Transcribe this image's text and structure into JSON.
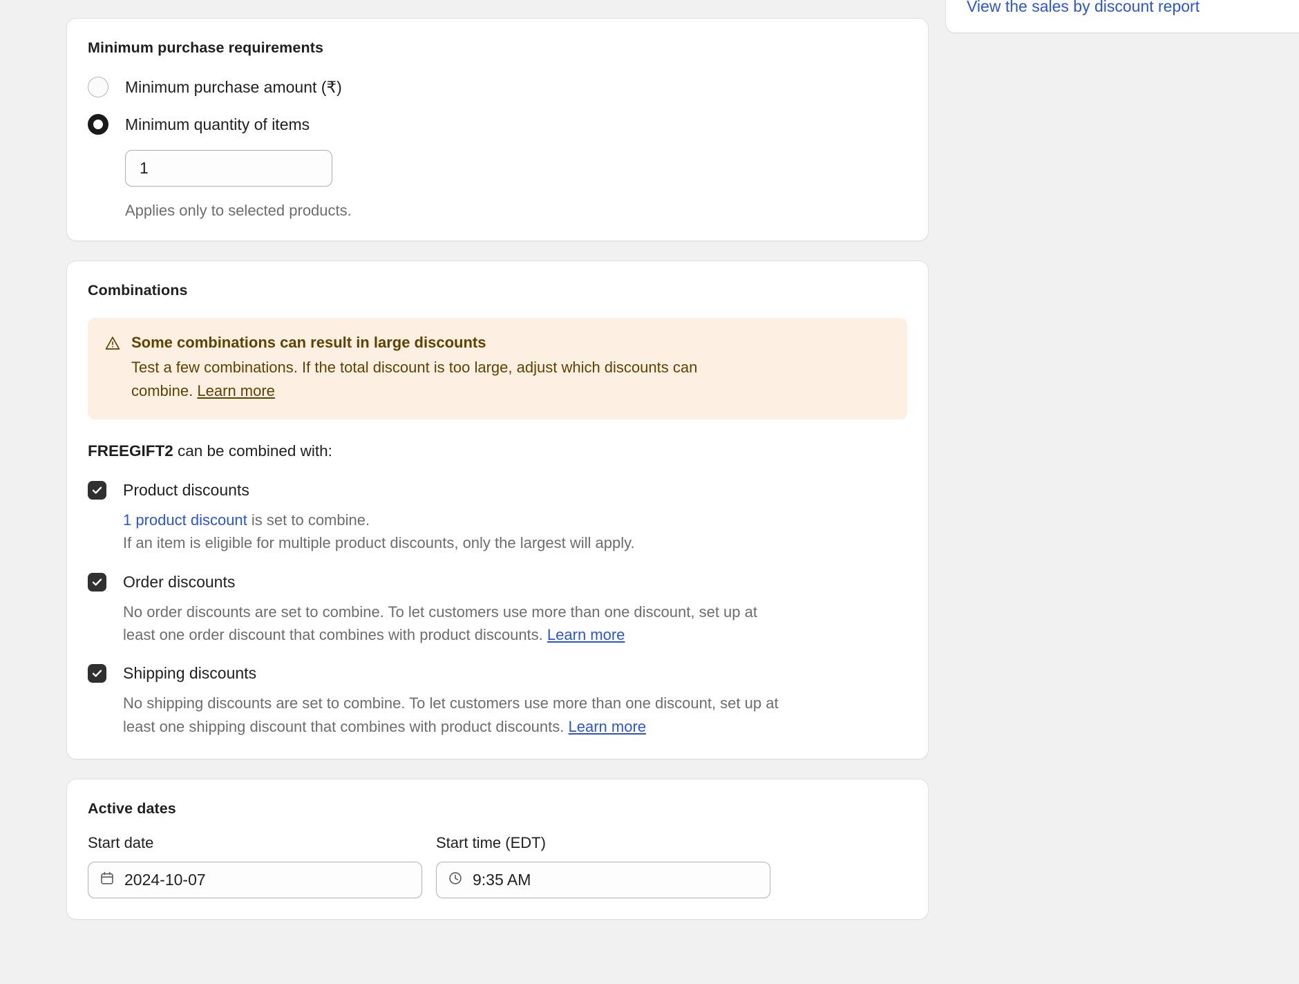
{
  "min_purchase": {
    "title": "Minimum purchase requirements",
    "options": [
      {
        "label": "Minimum purchase amount (₹)",
        "selected": false
      },
      {
        "label": "Minimum quantity of items",
        "selected": true
      }
    ],
    "quantity_value": "1",
    "helper": "Applies only to selected products."
  },
  "combinations": {
    "title": "Combinations",
    "banner": {
      "icon": "warning-icon",
      "title": "Some combinations can result in large discounts",
      "body_prefix": "Test a few combinations. If the total discount is too large, adjust which discounts can combine.",
      "link_label": "Learn more",
      "bg_color": "#fdf0e3",
      "text_color": "#5e4200"
    },
    "intro_code": "FREEGIFT2",
    "intro_rest": " can be combined with:",
    "items": [
      {
        "label": "Product discounts",
        "checked": true,
        "sub_link": "1 product discount",
        "sub_after": " is set to combine.",
        "sub_line2": "If an item is eligible for multiple product discounts, only the largest will apply."
      },
      {
        "label": "Order discounts",
        "checked": true,
        "sub_text": "No order discounts are set to combine. To let customers use more than one discount, set up at least one order discount that combines with product discounts. ",
        "sub_link_label": "Learn more"
      },
      {
        "label": "Shipping discounts",
        "checked": true,
        "sub_text": "No shipping discounts are set to combine. To let customers use more than one discount, set up at least one shipping discount that combines with product discounts. ",
        "sub_link_label": "Learn more"
      }
    ]
  },
  "active_dates": {
    "title": "Active dates",
    "start_date_label": "Start date",
    "start_date_value": "2024-10-07",
    "start_date_icon": "calendar-icon",
    "start_time_label": "Start time (EDT)",
    "start_time_value": "9:35 AM",
    "start_time_icon": "clock-icon"
  },
  "right_panel": {
    "report_link": "View the sales by discount report",
    "link_color": "#2c55d6"
  }
}
